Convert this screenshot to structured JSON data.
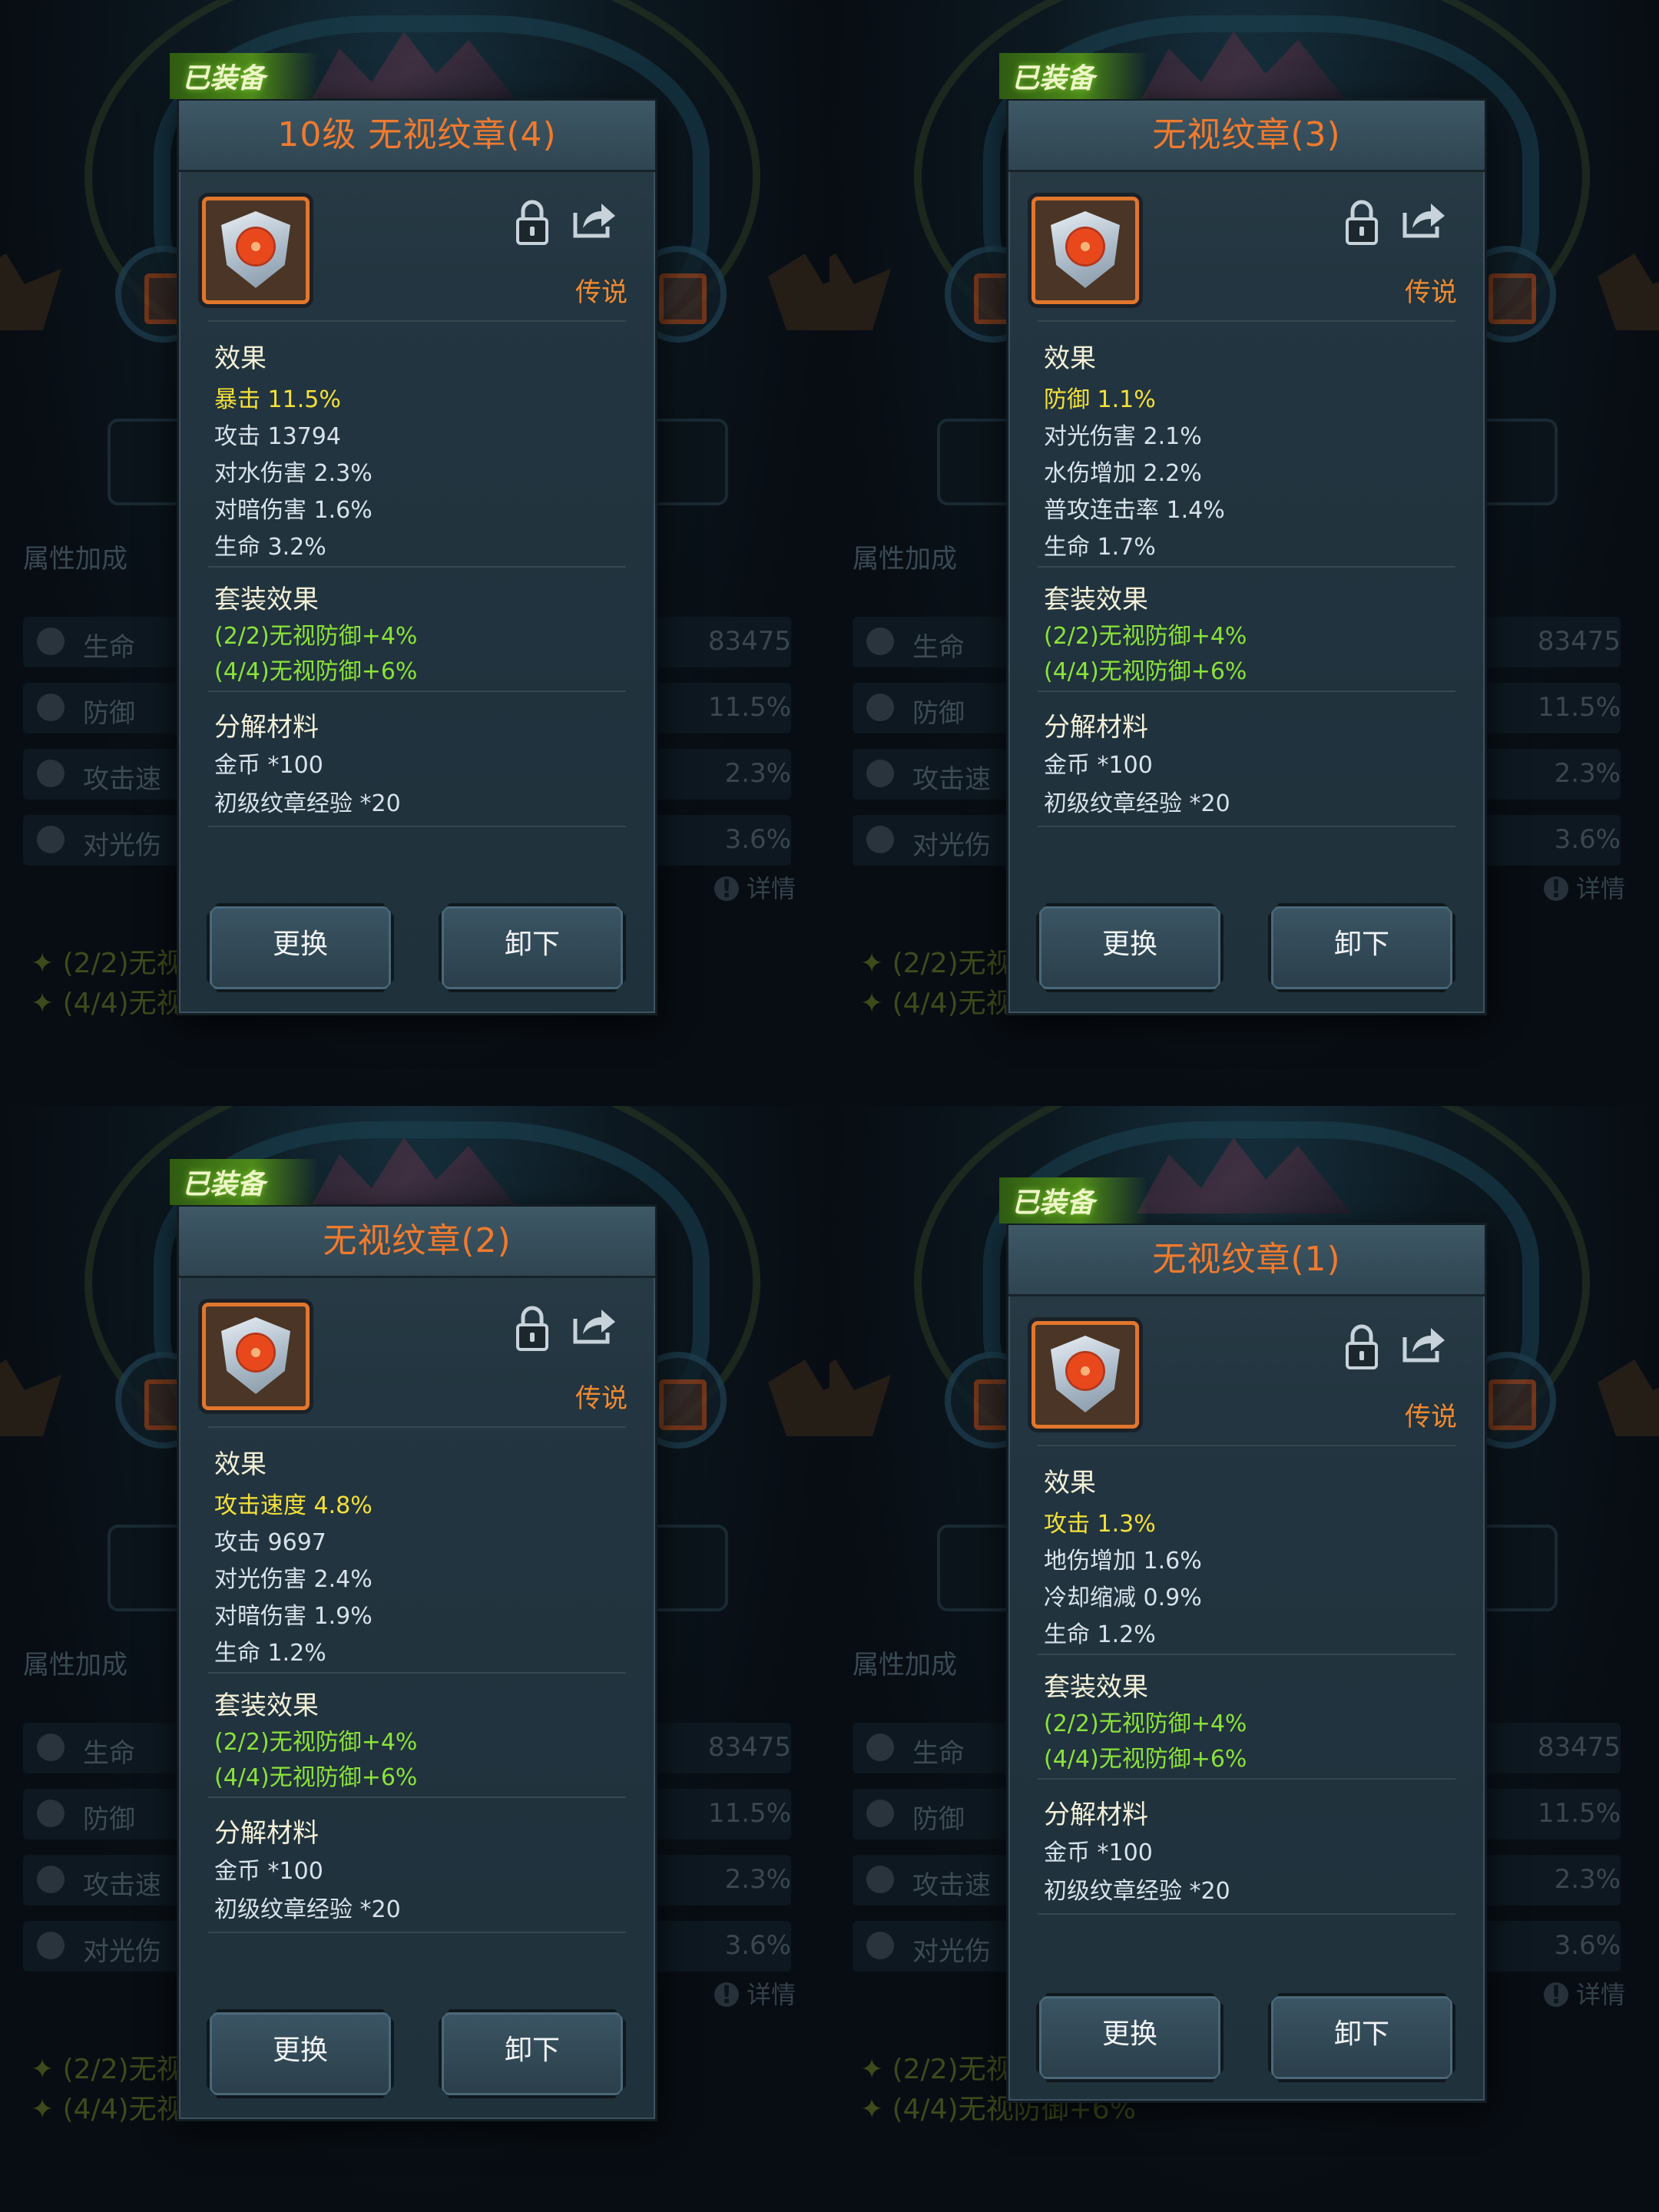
{
  "background": {
    "section_title": "属性加成",
    "stats": [
      {
        "label": "生命",
        "value": "83475"
      },
      {
        "label": "防御",
        "value": "11.5%"
      },
      {
        "label": "攻击速",
        "value": "2.3%"
      },
      {
        "label": "对光伤",
        "value": "3.6%"
      }
    ],
    "detail_label": "详情",
    "set_lines": [
      "(2/2)无视",
      "(4/4)无视"
    ],
    "set_line_full": "(4/4)无视防御+6%"
  },
  "cards": [
    {
      "badge": "已装备",
      "title": "10级 无视纹章(4)",
      "rarity": "传说",
      "effects_title": "效果",
      "effects": [
        "暴击  11.5%",
        "攻击  13794",
        "对水伤害  2.3%",
        "对暗伤害  1.6%",
        "生命  3.2%"
      ],
      "set_title": "套装效果",
      "set_effects": [
        "(2/2)无视防御+4%",
        "(4/4)无视防御+6%"
      ],
      "decompose_title": "分解材料",
      "materials": [
        "金币 *100",
        "初级纹章经验 *20"
      ],
      "replace_label": "更换",
      "unequip_label": "卸下"
    },
    {
      "badge": "已装备",
      "title": "无视纹章(3)",
      "rarity": "传说",
      "effects_title": "效果",
      "effects": [
        "防御  1.1%",
        "对光伤害  2.1%",
        "水伤增加  2.2%",
        "普攻连击率  1.4%",
        "生命  1.7%"
      ],
      "set_title": "套装效果",
      "set_effects": [
        "(2/2)无视防御+4%",
        "(4/4)无视防御+6%"
      ],
      "decompose_title": "分解材料",
      "materials": [
        "金币 *100",
        "初级纹章经验 *20"
      ],
      "replace_label": "更换",
      "unequip_label": "卸下"
    },
    {
      "badge": "已装备",
      "title": "无视纹章(2)",
      "rarity": "传说",
      "effects_title": "效果",
      "effects": [
        "攻击速度  4.8%",
        "攻击  9697",
        "对光伤害  2.4%",
        "对暗伤害  1.9%",
        "生命  1.2%"
      ],
      "set_title": "套装效果",
      "set_effects": [
        "(2/2)无视防御+4%",
        "(4/4)无视防御+6%"
      ],
      "decompose_title": "分解材料",
      "materials": [
        "金币 *100",
        "初级纹章经验 *20"
      ],
      "replace_label": "更换",
      "unequip_label": "卸下"
    },
    {
      "badge": "已装备",
      "title": "无视纹章(1)",
      "rarity": "传说",
      "effects_title": "效果",
      "effects": [
        "攻击  1.3%",
        "地伤增加  1.6%",
        "冷却缩减  0.9%",
        "生命  1.2%"
      ],
      "set_title": "套装效果",
      "set_effects": [
        "(2/2)无视防御+4%",
        "(4/4)无视防御+6%"
      ],
      "decompose_title": "分解材料",
      "materials": [
        "金币 *100",
        "初级纹章经验 *20"
      ],
      "replace_label": "更换",
      "unequip_label": "卸下"
    }
  ],
  "colors": {
    "title": "#f07a2e",
    "rarity": "#f08a30",
    "highlight_stat": "#f4e03a",
    "set_effect": "#8ae23a",
    "equipped_badge": "#4e8a1a"
  }
}
